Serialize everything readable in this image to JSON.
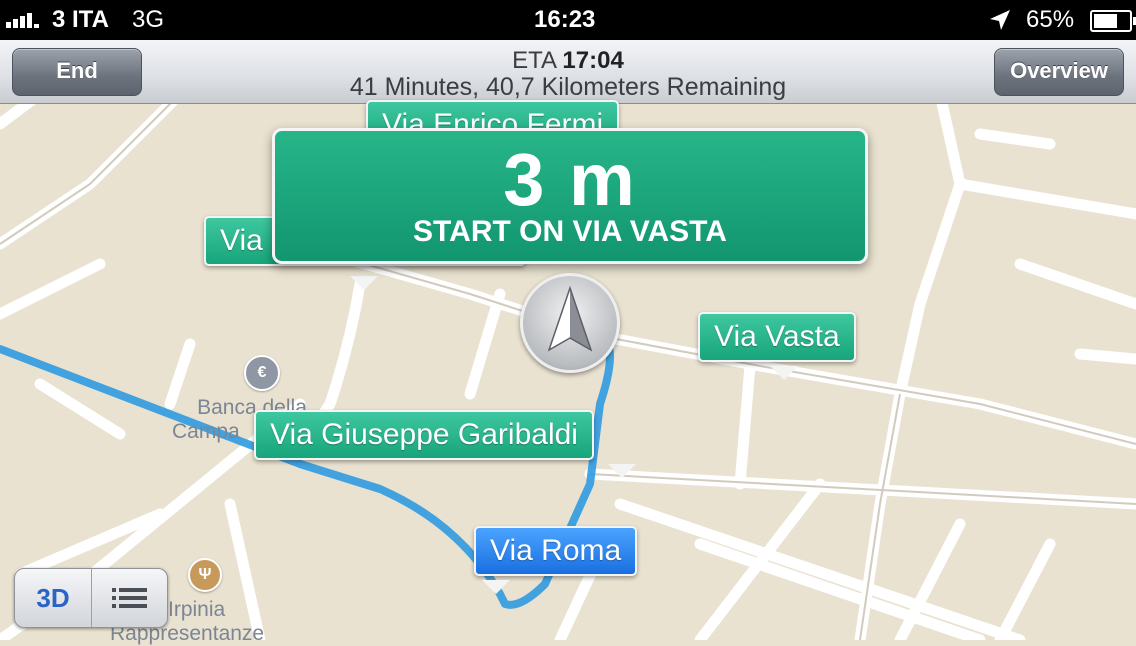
{
  "status_bar": {
    "carrier": "3 ITA",
    "network": "3G",
    "time": "16:23",
    "battery": "65%"
  },
  "nav_bar": {
    "end_button": "End",
    "overview_button": "Overview",
    "eta_label": "ETA",
    "eta_time": "17:04",
    "remaining": "41 Minutes, 40,7 Kilometers Remaining"
  },
  "maneuver": {
    "distance": "3 m",
    "instruction": "START ON VIA VASTA"
  },
  "street_labels": {
    "enrico_fermi": "Via Enrico Fermi",
    "via_partial": "Via",
    "vasta": "Via Vasta",
    "garibaldi": "Via Giuseppe Garibaldi",
    "roma": "Via Roma"
  },
  "pois": {
    "bank_line1": "Banca della",
    "bank_line2": "Campa",
    "restaurant_line1": "Irpinia",
    "restaurant_line2": "Rappresentanze"
  },
  "controls": {
    "three_d": "3D"
  },
  "icons": [
    "location-arrow-icon",
    "battery-icon",
    "signal-icon",
    "compass-arrow-icon",
    "bank-icon",
    "restaurant-icon",
    "list-icon"
  ],
  "colors": {
    "route": "#2f9be0",
    "sign_green": "#18a57b",
    "label_blue": "#1a6fe0",
    "map_bg": "#e9e2d0"
  }
}
